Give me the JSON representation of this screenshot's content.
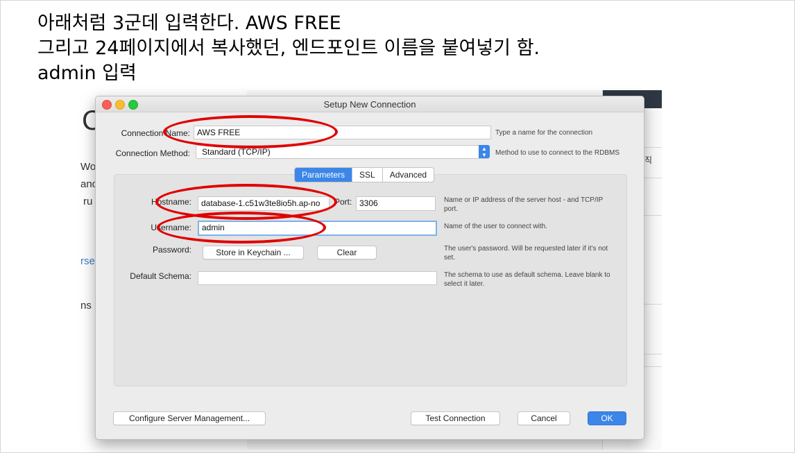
{
  "slide": {
    "lines": [
      "아래처럼 3군데 입력한다. AWS FREE",
      "그리고 24페이지에서 복사했던, 엔드포인트 이름을 붙여넣기 함.",
      "admin 입력"
    ]
  },
  "background": {
    "big_letter": "C",
    "fragments": [
      "Wor",
      "anc",
      "ru",
      "rse",
      "ns"
    ],
    "right_tab": "직"
  },
  "dialog": {
    "title": "Setup New Connection",
    "connection_name": {
      "label": "Connection Name:",
      "value": "AWS FREE",
      "hint": "Type a name for the connection"
    },
    "connection_method": {
      "label": "Connection Method:",
      "value": "Standard (TCP/IP)",
      "hint": "Method to use to connect to the RDBMS"
    },
    "tabs": [
      {
        "label": "Parameters",
        "active": true
      },
      {
        "label": "SSL",
        "active": false
      },
      {
        "label": "Advanced",
        "active": false
      }
    ],
    "hostname": {
      "label": "Hostname:",
      "value": "database-1.c51w3te8io5h.ap-no",
      "hint": "Name or IP address of the server host - and TCP/IP port."
    },
    "port": {
      "label": "Port:",
      "value": "3306"
    },
    "username": {
      "label": "Username:",
      "value": "admin",
      "hint": "Name of the user to connect with."
    },
    "password": {
      "label": "Password:",
      "store_button": "Store in Keychain ...",
      "clear_button": "Clear",
      "hint": "The user's password. Will be requested later if it's not set."
    },
    "default_schema": {
      "label": "Default Schema:",
      "value": "",
      "hint": "The schema to use as default schema. Leave blank to select it later."
    },
    "buttons": {
      "configure": "Configure Server Management...",
      "test": "Test Connection",
      "cancel": "Cancel",
      "ok": "OK"
    }
  },
  "colors": {
    "annotation": "#e10000",
    "accent": "#3b86e8"
  }
}
